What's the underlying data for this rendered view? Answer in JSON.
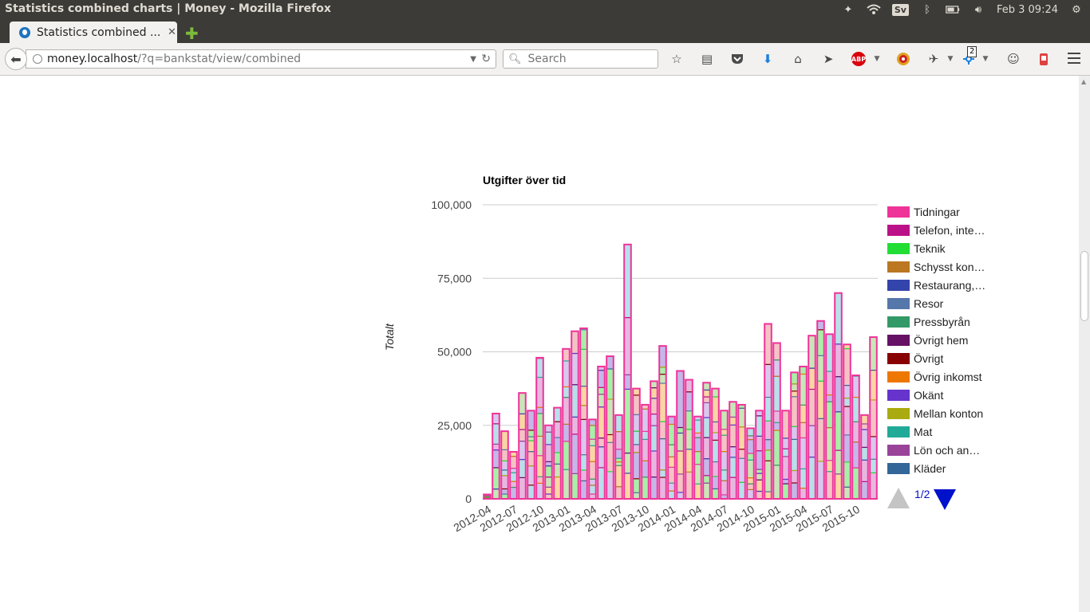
{
  "os": {
    "window_title": "Statistics combined charts | Money - Mozilla Firefox",
    "lang": "Sv",
    "clock": "Feb  3 09:24"
  },
  "browser": {
    "tab_title": "Statistics combined ...",
    "url_host": "money.localhost",
    "url_path": "/?q=bankstat/view/combined",
    "search_placeholder": "Search",
    "toolbar_badge": "2"
  },
  "chart_data": {
    "type": "bar",
    "stacked": true,
    "title": "Utgifter över tid",
    "ylabel": "Totalt",
    "xlabel": "",
    "ylim": [
      0,
      100000
    ],
    "yticks": [
      "0",
      "25,000",
      "50,000",
      "75,000",
      "100,000"
    ],
    "xtick_labels": [
      "2012-04",
      "2012-07",
      "2012-10",
      "2013-01",
      "2013-04",
      "2013-07",
      "2013-10",
      "2014-01",
      "2014-04",
      "2014-07",
      "2014-10",
      "2015-01",
      "2015-04",
      "2015-07",
      "2015-10"
    ],
    "grid": true,
    "legend_position": "right",
    "legend": [
      {
        "name": "Tidningar",
        "color": "#ee3399"
      },
      {
        "name": "Telefon, inte…",
        "color": "#bb1188"
      },
      {
        "name": "Teknik",
        "color": "#22dd33"
      },
      {
        "name": "Schysst kon…",
        "color": "#bb7722"
      },
      {
        "name": "Restaurang,…",
        "color": "#3344aa"
      },
      {
        "name": "Resor",
        "color": "#5577aa"
      },
      {
        "name": "Pressbyrån",
        "color": "#339966"
      },
      {
        "name": "Övrigt hem",
        "color": "#661166"
      },
      {
        "name": "Övrigt",
        "color": "#880000"
      },
      {
        "name": "Övrig inkomst",
        "color": "#ee7700"
      },
      {
        "name": "Okänt",
        "color": "#6633cc"
      },
      {
        "name": "Mellan konton",
        "color": "#aaaa11"
      },
      {
        "name": "Mat",
        "color": "#22aa99"
      },
      {
        "name": "Lön och an…",
        "color": "#994499"
      },
      {
        "name": "Kläder",
        "color": "#336699"
      }
    ],
    "months": [
      "2012-04",
      "2012-05",
      "2012-06",
      "2012-07",
      "2012-08",
      "2012-09",
      "2012-10",
      "2012-11",
      "2012-12",
      "2013-01",
      "2013-02",
      "2013-03",
      "2013-04",
      "2013-05",
      "2013-06",
      "2013-07",
      "2013-08",
      "2013-09",
      "2013-10",
      "2013-11",
      "2013-12",
      "2014-01",
      "2014-02",
      "2014-03",
      "2014-04",
      "2014-05",
      "2014-06",
      "2014-07",
      "2014-08",
      "2014-09",
      "2014-10",
      "2014-11",
      "2014-12",
      "2015-01",
      "2015-02",
      "2015-03",
      "2015-04",
      "2015-05",
      "2015-06",
      "2015-07",
      "2015-08",
      "2015-09",
      "2015-10",
      "2015-11",
      "2015-12"
    ],
    "totals": [
      1500,
      29000,
      23000,
      16000,
      36000,
      30000,
      48000,
      25000,
      31000,
      51000,
      57000,
      58000,
      27000,
      45000,
      48500,
      28500,
      86500,
      37500,
      32000,
      40000,
      52000,
      28000,
      43500,
      40500,
      28000,
      39500,
      37500,
      30000,
      33000,
      32000,
      24000,
      30000,
      59500,
      53000,
      30000,
      43000,
      45000,
      55500,
      60500,
      56000,
      70000,
      52500,
      42000,
      28500,
      55000
    ]
  },
  "pager": {
    "text": "1/2"
  }
}
